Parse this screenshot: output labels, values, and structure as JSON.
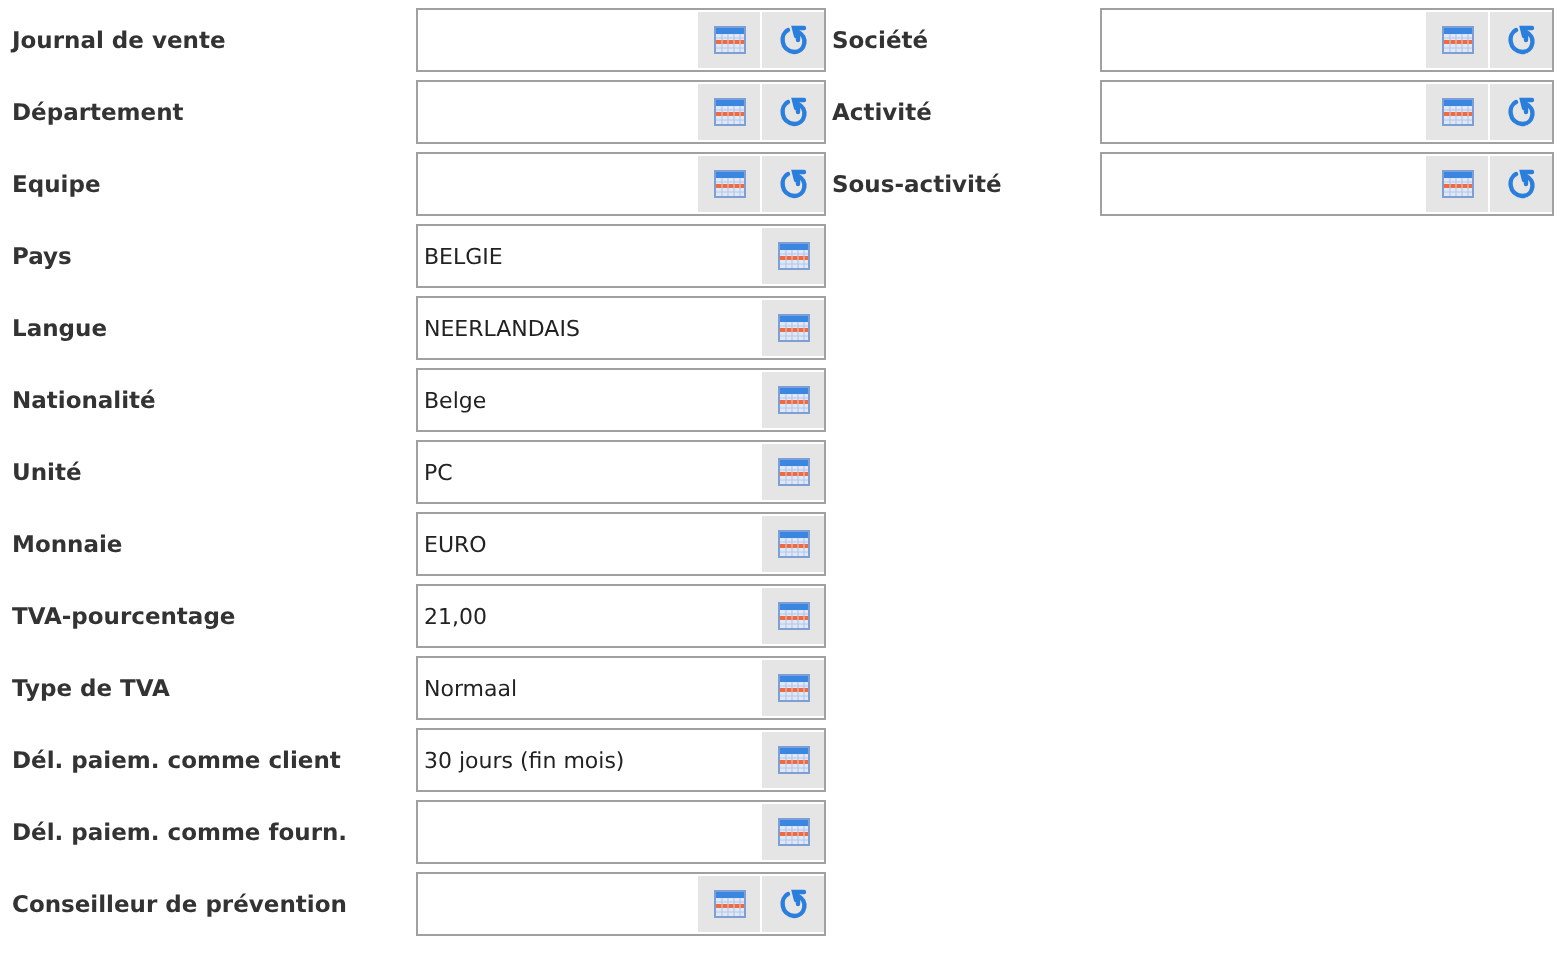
{
  "rows": [
    {
      "left": {
        "label": "Journal de vente",
        "kind": "lookup_reset"
      },
      "right": {
        "label": "Société",
        "kind": "lookup_reset"
      }
    },
    {
      "left": {
        "label": "Département",
        "kind": "lookup_reset"
      },
      "right": {
        "label": "Activité",
        "kind": "lookup_reset"
      }
    },
    {
      "left": {
        "label": "Equipe",
        "kind": "lookup_reset"
      },
      "right": {
        "label": "Sous-activité",
        "kind": "lookup_reset"
      }
    },
    {
      "left": {
        "label": "Pays",
        "value": "BELGIE",
        "kind": "lookup"
      }
    },
    {
      "left": {
        "label": "Langue",
        "value": "NEERLANDAIS",
        "kind": "lookup"
      }
    },
    {
      "left": {
        "label": "Nationalité",
        "value": "Belge",
        "kind": "lookup"
      }
    },
    {
      "left": {
        "label": "Unité",
        "value": "PC",
        "kind": "lookup"
      }
    },
    {
      "left": {
        "label": "Monnaie",
        "value": "EURO",
        "kind": "lookup"
      }
    },
    {
      "left": {
        "label": "TVA-pourcentage",
        "value": "21,00",
        "kind": "lookup"
      }
    },
    {
      "left": {
        "label": "Type de TVA",
        "value": "Normaal",
        "kind": "lookup"
      }
    },
    {
      "left": {
        "label": "Dél. paiem. comme client",
        "value": "30 jours (fin mois)",
        "kind": "lookup"
      }
    },
    {
      "left": {
        "label": "Dél. paiem. comme fourn.",
        "kind": "lookup"
      }
    },
    {
      "left": {
        "label": "Conseilleur de prévention",
        "kind": "lookup_reset"
      }
    }
  ]
}
